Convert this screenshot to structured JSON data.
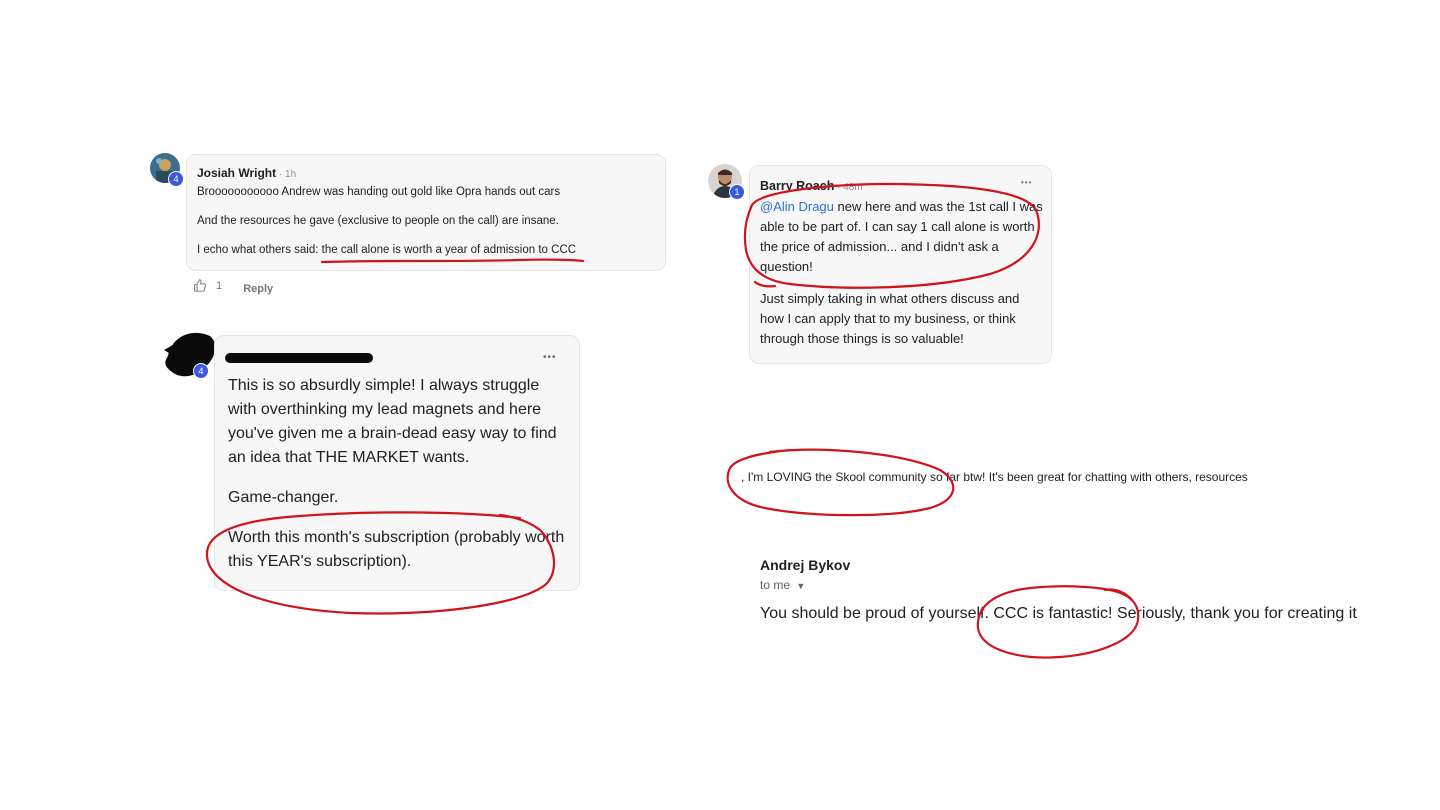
{
  "comment1": {
    "author": "Josiah Wright",
    "time": " · 1h",
    "level": "4",
    "paragraphs": [
      "Brooooooooooo Andrew was handing out gold like Opra hands out cars",
      "And the resources he gave (exclusive to people on the call) are insane."
    ],
    "line3_prefix": "I echo what others said: ",
    "line3_highlight": "the call alone is worth a year of admission to CCC",
    "like_count": "1",
    "reply_label": "Reply"
  },
  "comment2": {
    "level": "4",
    "more": "•••",
    "paragraphs": [
      "This is so absurdly simple! I always struggle with overthinking my lead magnets and here you've given me a brain-dead easy way to find an idea that THE MARKET wants.",
      "Game-changer.",
      "Worth this month's subscription (probably worth this YEAR's subscription)."
    ]
  },
  "comment3": {
    "author": "Barry Roach",
    "time": " · 48m",
    "level": "1",
    "more": "•••",
    "mention": "@Alin Dragu",
    "para1_rest": " new here and was the 1st call I was able to be part of. I can say 1 call alone is worth the price of admission... and I didn't ask a question!",
    "para2": "Just simply taking in what others discuss and how I can apply that to my business, or think through those things is so valuable!"
  },
  "snippet": {
    "text": ", I'm LOVING the Skool community so far btw! It's been great for chatting with others, resources"
  },
  "email": {
    "sender": "Andrej Bykov",
    "to": "to me",
    "body": "You should be proud of yourself. CCC is fantastic! Seriously, thank you for creating it"
  },
  "colors": {
    "ink": "#d0141b",
    "mention": "#2f6fd6",
    "badge": "#3b5bdb"
  }
}
